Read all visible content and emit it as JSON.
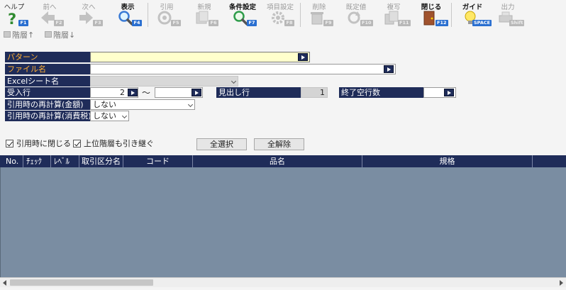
{
  "toolbar": {
    "buttons": [
      {
        "label": "ヘルプ",
        "key": "F1",
        "icon": "help-icon"
      },
      {
        "label": "前へ",
        "key": "F2",
        "icon": "prev-arrow-icon"
      },
      {
        "label": "次へ",
        "key": "F3",
        "icon": "next-arrow-icon"
      },
      {
        "label": "表示",
        "key": "F4",
        "icon": "search-icon"
      },
      {
        "label": "引用",
        "key": "F5",
        "icon": "cite-icon"
      },
      {
        "label": "新規",
        "key": "F6",
        "icon": "new-document-icon"
      },
      {
        "label": "条件設定",
        "key": "F7",
        "icon": "condition-search-icon"
      },
      {
        "label": "項目設定",
        "key": "F8",
        "icon": "gear-icon"
      },
      {
        "label": "削除",
        "key": "F9",
        "icon": "trash-icon"
      },
      {
        "label": "既定値",
        "key": "F10",
        "icon": "reset-icon"
      },
      {
        "label": "複写",
        "key": "F11",
        "icon": "copy-icon"
      },
      {
        "label": "閉じる",
        "key": "F12",
        "icon": "close-door-icon"
      },
      {
        "label": "ガイド",
        "key": "SPACE",
        "icon": "lightbulb-icon"
      },
      {
        "label": "出力",
        "key": "Shift",
        "icon": "print-icon"
      }
    ],
    "hier_up": "階層↑",
    "hier_down": "階層↓"
  },
  "form": {
    "pattern_label": "パターン",
    "pattern_value": "",
    "file_label": "ファイル名",
    "file_value": "",
    "sheet_label": "Excelシート名",
    "sheet_value": "",
    "receive_row_label": "受入行",
    "receive_row_from": "2",
    "range_sep": "～",
    "receive_row_to": "",
    "header_row_label": "見出し行",
    "header_row_value": "1",
    "end_blank_label": "終了空行数",
    "end_blank_value": "",
    "recalc_amount_label": "引用時の再計算(金額)",
    "recalc_amount_value": "しない",
    "recalc_tax_label": "引用時の再計算(消費税)",
    "recalc_tax_value": "しない"
  },
  "options": {
    "close_on_cite": "引用時に閉じる",
    "inherit_parent": "上位階層も引き継ぐ",
    "select_all": "全選択",
    "deselect_all": "全解除"
  },
  "grid": {
    "columns": [
      "No.",
      "ﾁｪｯｸ",
      "ﾚﾍﾞﾙ",
      "取引区分名",
      "コード",
      "品名",
      "規格"
    ]
  }
}
